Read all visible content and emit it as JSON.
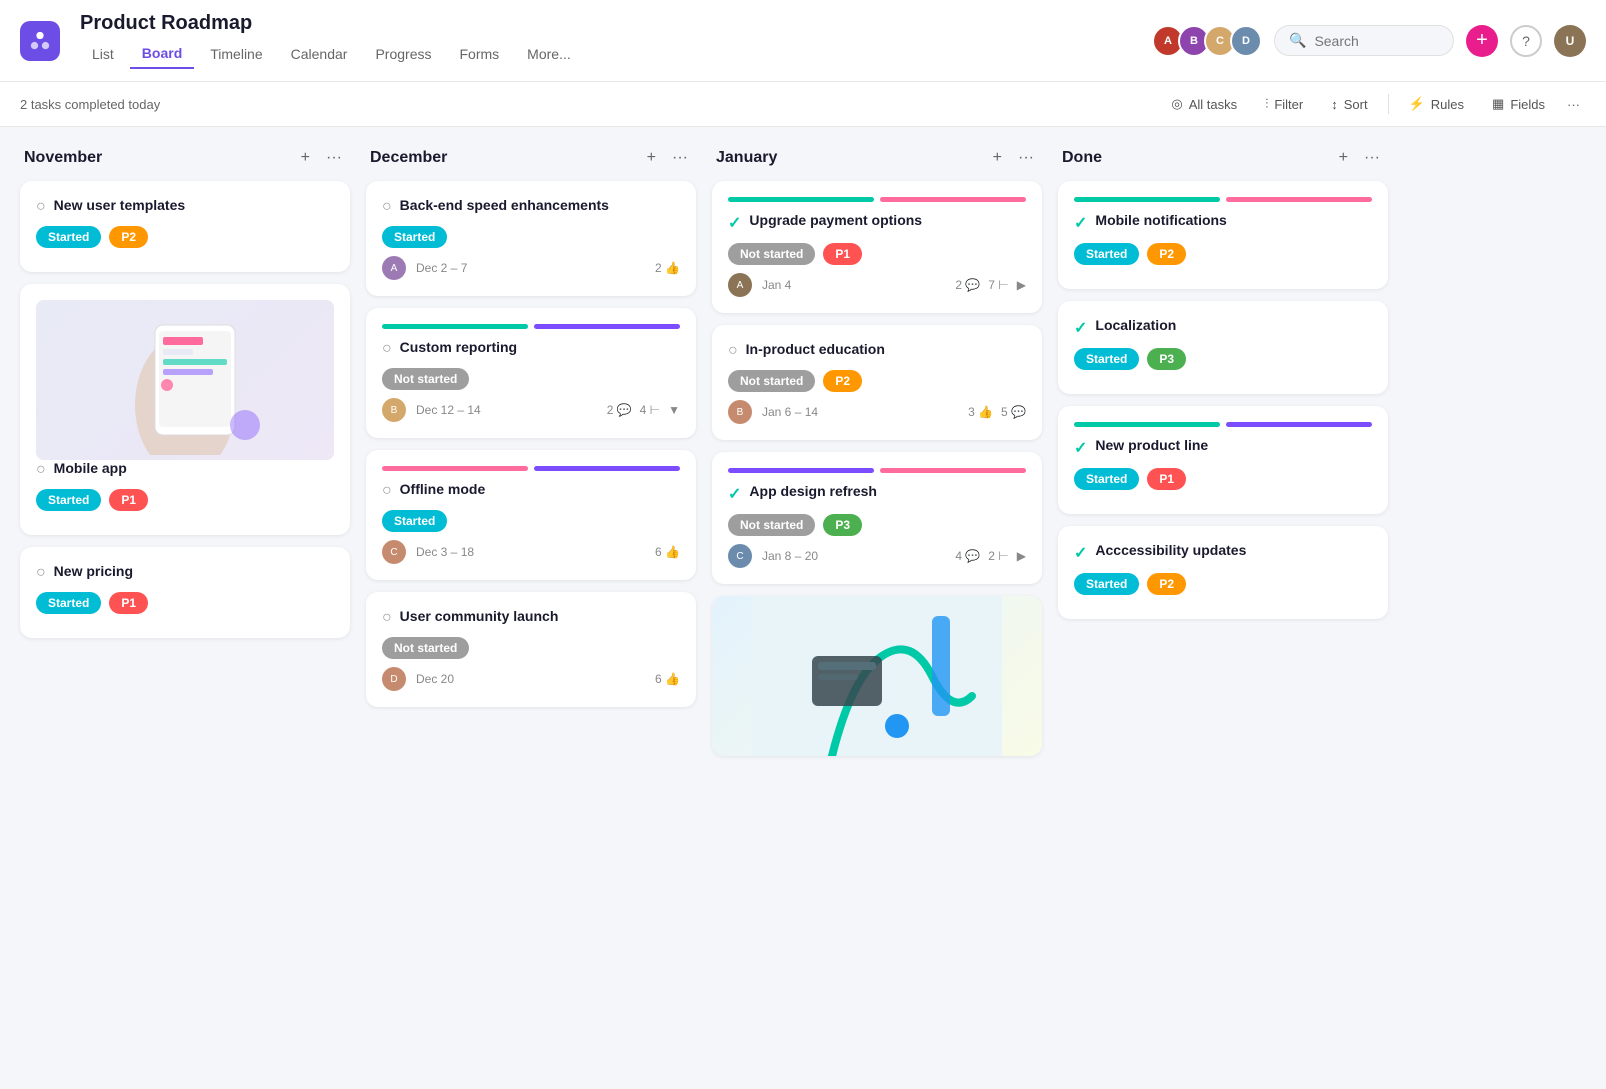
{
  "app": {
    "logo_alt": "Asana logo",
    "title": "Product Roadmap",
    "nav": [
      "List",
      "Board",
      "Timeline",
      "Calendar",
      "Progress",
      "Forms",
      "More..."
    ],
    "active_nav": "Board",
    "tasks_completed": "2 tasks completed today",
    "toolbar": {
      "all_tasks": "All tasks",
      "filter": "Filter",
      "sort": "Sort",
      "rules": "Rules",
      "fields": "Fields"
    }
  },
  "columns": [
    {
      "id": "november",
      "title": "November",
      "cards": [
        {
          "id": "new-user-templates",
          "title": "New user templates",
          "status": "started",
          "priority": "P2",
          "has_image": false,
          "check_done": false
        },
        {
          "id": "mobile-app",
          "title": "Mobile app",
          "status": "started",
          "priority": "P1",
          "has_image": true,
          "check_done": false
        },
        {
          "id": "new-pricing",
          "title": "New pricing",
          "status": "started",
          "priority": "P1",
          "has_image": false,
          "check_done": false
        }
      ]
    },
    {
      "id": "december",
      "title": "December",
      "cards": [
        {
          "id": "backend-speed",
          "title": "Back-end speed enhancements",
          "status": "started",
          "priority": null,
          "date": "Dec 2 – 7",
          "likes": "2",
          "has_progress": false,
          "check_done": false,
          "avatar_color": "#9c7bb5"
        },
        {
          "id": "custom-reporting",
          "title": "Custom reporting",
          "status": "not-started",
          "priority": null,
          "date": "Dec 12 – 14",
          "comments": "2",
          "subtasks": "4",
          "has_progress": true,
          "bar1": "green",
          "bar2": "purple",
          "check_done": false,
          "avatar_color": "#d4a76a"
        },
        {
          "id": "offline-mode",
          "title": "Offline mode",
          "status": "started",
          "priority": null,
          "date": "Dec 3 – 18",
          "likes": "6",
          "has_progress": true,
          "bar1": "pink",
          "bar2": "purple",
          "check_done": false,
          "avatar_color": "#c68b6e"
        },
        {
          "id": "user-community-launch",
          "title": "User community launch",
          "status": "not-started",
          "priority": null,
          "date": "Dec 20",
          "likes": "6",
          "has_progress": false,
          "check_done": false,
          "avatar_color": "#c68b6e"
        }
      ]
    },
    {
      "id": "january",
      "title": "January",
      "cards": [
        {
          "id": "upgrade-payment",
          "title": "Upgrade payment options",
          "status": "not-started",
          "priority": "P1",
          "date": "Jan 4",
          "comments": "2",
          "subtasks": "7",
          "has_progress": true,
          "bar1": "green",
          "bar2": "pink",
          "check_done": false,
          "avatar_color": "#8b7355"
        },
        {
          "id": "in-product-education",
          "title": "In-product education",
          "status": "not-started",
          "priority": "P2",
          "date": "Jan 6 – 14",
          "likes": "3",
          "comments": "5",
          "has_progress": false,
          "check_done": false,
          "avatar_color": "#c68b6e"
        },
        {
          "id": "app-design-refresh",
          "title": "App design refresh",
          "status": "not-started",
          "priority": "P3",
          "date": "Jan 8 – 20",
          "comments": "4",
          "subtasks": "2",
          "has_progress": true,
          "bar1": "purple",
          "bar2": "pink",
          "check_done": false,
          "avatar_color": "#6b8cad"
        },
        {
          "id": "jan-image-card",
          "title": "",
          "has_image_only": true
        }
      ]
    },
    {
      "id": "done",
      "title": "Done",
      "cards": [
        {
          "id": "mobile-notifications",
          "title": "Mobile notifications",
          "status": "started",
          "priority": "P2",
          "has_progress": true,
          "bar1": "green",
          "bar2": "pink",
          "check_done": true
        },
        {
          "id": "localization",
          "title": "Localization",
          "status": "started",
          "priority": "P3",
          "has_progress": false,
          "check_done": true
        },
        {
          "id": "new-product-line",
          "title": "New product line",
          "status": "started",
          "priority": "P1",
          "has_progress": true,
          "bar1": "green",
          "bar2": "purple",
          "check_done": true
        },
        {
          "id": "accessibility-updates",
          "title": "Acccessibility updates",
          "status": "started",
          "priority": "P2",
          "has_progress": false,
          "check_done": true
        }
      ]
    }
  ]
}
